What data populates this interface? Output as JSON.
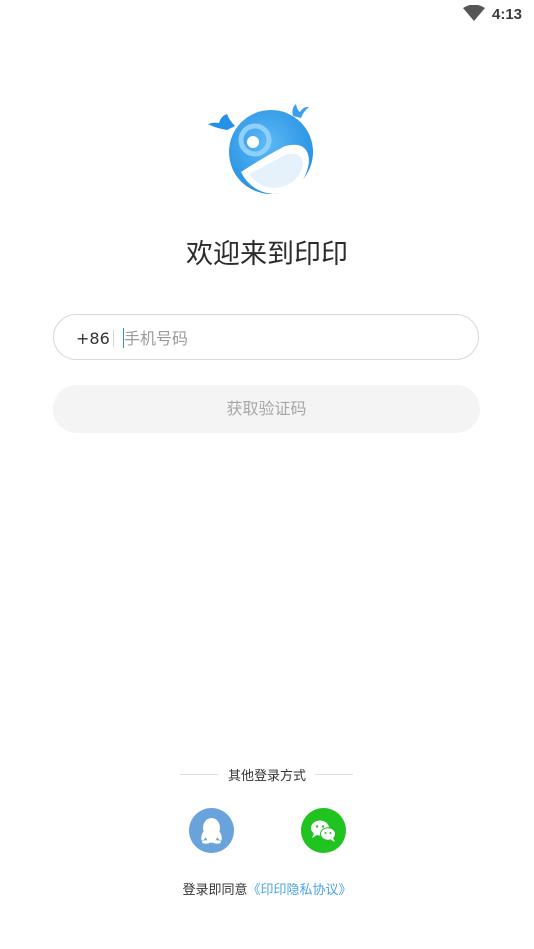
{
  "status_bar": {
    "time": "4:13",
    "wifi_icon": "wifi-icon"
  },
  "app": {
    "logo_icon": "whale-logo-icon",
    "welcome": "欢迎来到印印"
  },
  "login_form": {
    "country_code": "+86",
    "phone_placeholder": "手机号码",
    "phone_value": "",
    "get_code_label": "获取验证码"
  },
  "other_login": {
    "label": "其他登录方式",
    "options": [
      {
        "name": "QQ",
        "icon": "qq-icon",
        "color": "#6aa2dc"
      },
      {
        "name": "WeChat",
        "icon": "wechat-icon",
        "color": "#21c321"
      }
    ]
  },
  "agreement": {
    "prefix": "登录即同意",
    "link": "《印印隐私协议》"
  },
  "colors": {
    "accent": "#2d8cf0",
    "link": "#4aa3e6",
    "button_bg": "#f4f4f4",
    "button_text": "#a7a7a7"
  }
}
